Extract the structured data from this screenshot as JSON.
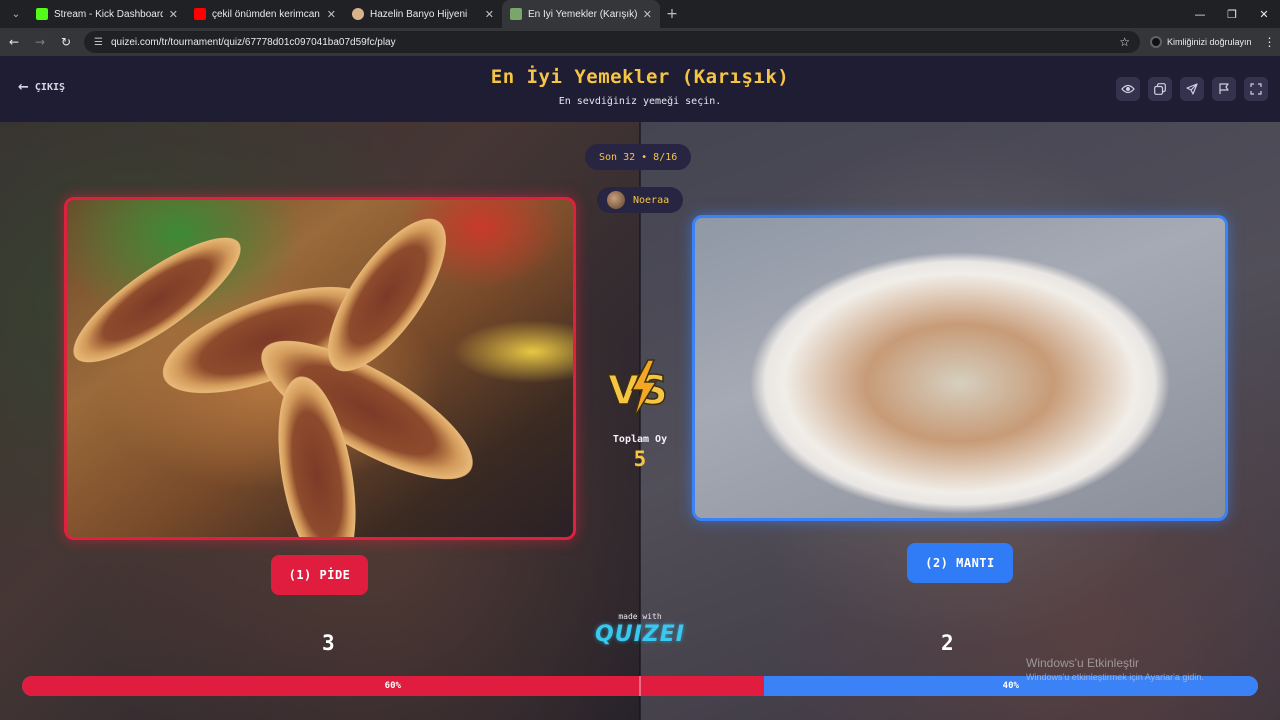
{
  "browser": {
    "tabs": [
      {
        "title": "Stream - Kick Dashboard",
        "favicon_color": "#53fc18"
      },
      {
        "title": "çekil önümden kerimcan durmaz",
        "favicon_color": "#ff0000"
      },
      {
        "title": "Hazelin Banyo Hijyeni",
        "favicon_color": "#d9b38c"
      },
      {
        "title": "En İyi Yemekler (Karışık) - Tier List",
        "favicon_color": "#7aa66b"
      }
    ],
    "url": "quizei.com/tr/tournament/quiz/67778d01c097041ba07d59fc/play",
    "profile_label": "Kimliğinizi doğrulayın"
  },
  "header": {
    "exit_label": "ÇIKIŞ",
    "title": "En İyi Yemekler (Karışık)",
    "subtitle": "En sevdiğiniz yemeği seçin.",
    "tools": [
      "eye-icon",
      "copy-icon",
      "send-icon",
      "flag-icon",
      "fullscreen-icon"
    ]
  },
  "round_label": "Son 32 • 8/16",
  "user_name": "Noeraa",
  "vs": {
    "total_label": "Toplam Oy",
    "total_value": "5"
  },
  "left_option": {
    "label": "(1) PİDE",
    "votes": "3",
    "percent_label": "60%",
    "share": 0.6,
    "color": "#e11d3f"
  },
  "right_option": {
    "label": "(2) MANTI",
    "votes": "2",
    "percent_label": "40%",
    "share": 0.4,
    "color": "#3b82f6"
  },
  "made_with": {
    "label": "made with",
    "brand": "QUIZEI"
  },
  "watermark": {
    "line1": "Windows'u Etkinleştir",
    "line2": "Windows'u etkinleştirmek için Ayarlar'a gidin."
  }
}
